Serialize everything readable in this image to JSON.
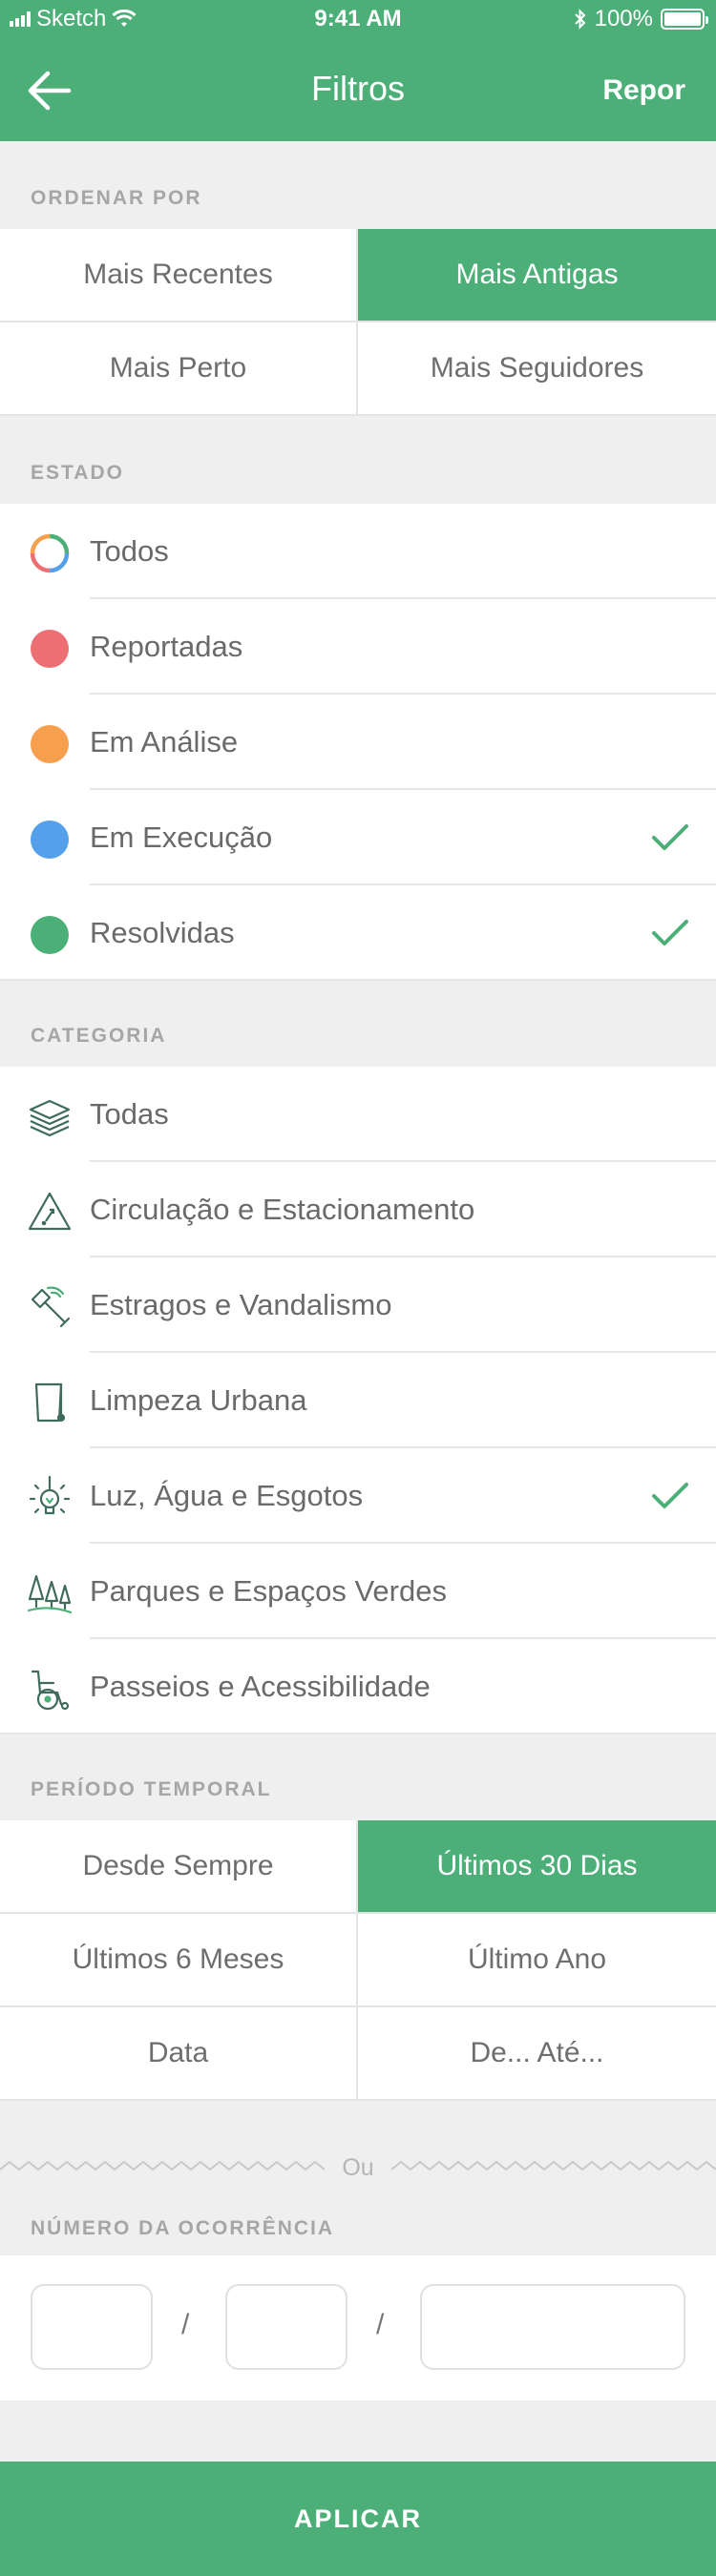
{
  "status_bar": {
    "carrier": "Sketch",
    "time": "9:41 AM",
    "battery": "100%"
  },
  "nav": {
    "title": "Filtros",
    "reset_label": "Repor"
  },
  "sort": {
    "header": "ORDENAR POR",
    "options": [
      "Mais Recentes",
      "Mais Antigas",
      "Mais Perto",
      "Mais Seguidores"
    ],
    "selected": "Mais Antigas"
  },
  "state": {
    "header": "ESTADO",
    "items": [
      {
        "label": "Todos",
        "color": "multi",
        "checked": false
      },
      {
        "label": "Reportadas",
        "color": "#ee6f73",
        "checked": false
      },
      {
        "label": "Em Análise",
        "color": "#f6a04d",
        "checked": false
      },
      {
        "label": "Em Execução",
        "color": "#54a0ea",
        "checked": true
      },
      {
        "label": "Resolvidas",
        "color": "#4caf78",
        "checked": true
      }
    ]
  },
  "category": {
    "header": "CATEGORIA",
    "items": [
      {
        "label": "Todas",
        "icon": "layers-icon",
        "checked": false
      },
      {
        "label": "Circulação e Estacionamento",
        "icon": "road-sign-icon",
        "checked": false
      },
      {
        "label": "Estragos e Vandalismo",
        "icon": "hammer-icon",
        "checked": false
      },
      {
        "label": "Limpeza Urbana",
        "icon": "trash-bin-icon",
        "checked": false
      },
      {
        "label": "Luz, Água e Esgotos",
        "icon": "lightbulb-icon",
        "checked": true
      },
      {
        "label": "Parques e Espaços Verdes",
        "icon": "trees-icon",
        "checked": false
      },
      {
        "label": "Passeios e Acessibilidade",
        "icon": "wheelchair-icon",
        "checked": false
      }
    ]
  },
  "period": {
    "header": "PERÍODO TEMPORAL",
    "options": [
      "Desde Sempre",
      "Últimos 30 Dias",
      "Últimos 6 Meses",
      "Último Ano",
      "Data",
      "De... Até..."
    ],
    "selected": "Últimos 30 Dias"
  },
  "divider_or": "Ou",
  "occurrence": {
    "header": "NÚMERO DA OCORRÊNCIA",
    "separator": "/"
  },
  "apply_label": "APLICAR",
  "colors": {
    "accent": "#4caf78",
    "check": "#4caf78",
    "background": "#efefef"
  }
}
